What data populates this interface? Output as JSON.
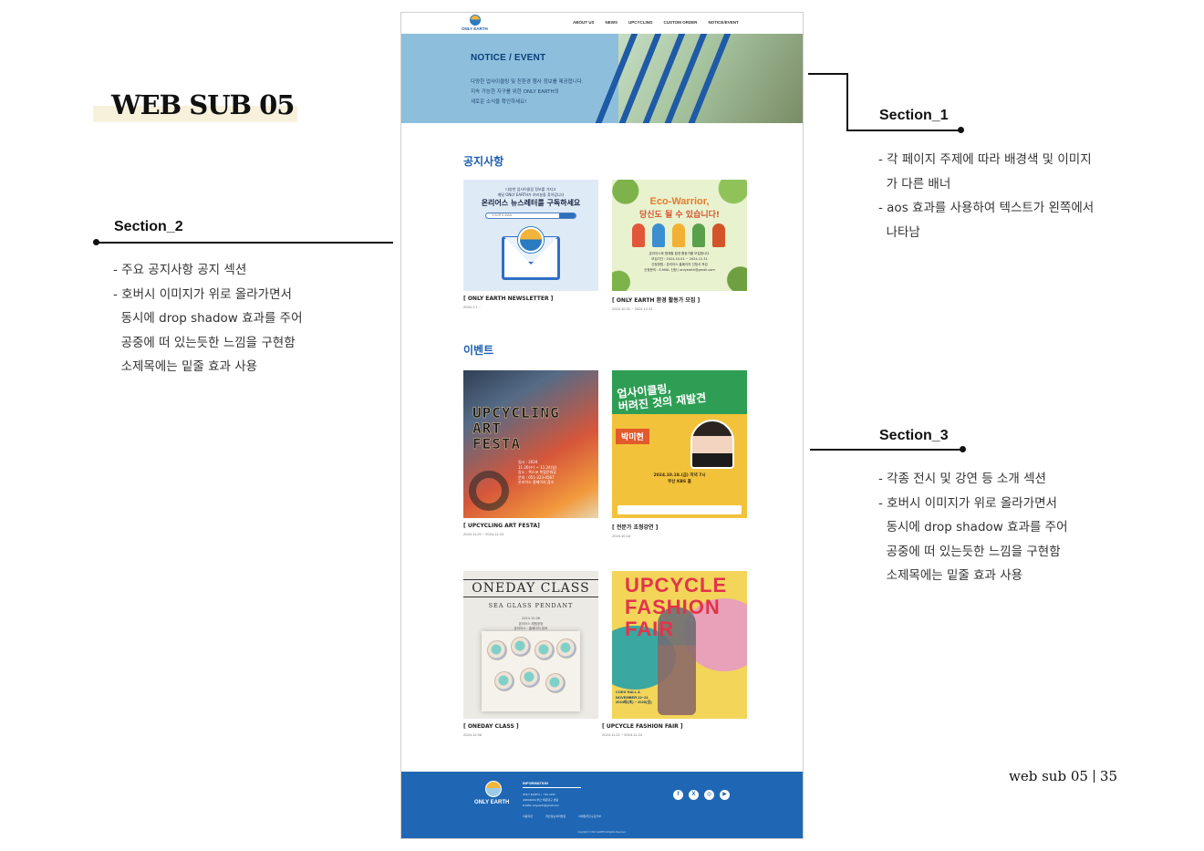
{
  "page_title": "WEB SUB 05",
  "page_number": {
    "label": "web sub 05",
    "num": "35"
  },
  "annotations": {
    "section1": {
      "heading": "Section_1",
      "notes": "- 각 페이지 주제에 따라 배경색 및 이미지\n  가 다른 배너\n- aos 효과를 사용하여 텍스트가 왼쪽에서\n  나타남"
    },
    "section2": {
      "heading": "Section_2",
      "notes": "- 주요 공지사항 공지 섹션\n- 호버시 이미지가 위로 올라가면서\n  동시에 drop shadow 효과를 주어\n  공중에 떠 있는듯한 느낌을 구현함\n  소제목에는 밑줄 효과 사용"
    },
    "section3": {
      "heading": "Section_3",
      "notes": "- 각종 전시 및 강연 등 소개 섹션\n- 호버시 이미지가 위로 올라가면서\n  동시에 drop shadow 효과를 주어\n  공중에 떠 있는듯한 느낌을 구현함\n  소제목에는 밑줄 효과 사용"
    }
  },
  "site": {
    "logo_text": "ONLY EARTH",
    "nav": [
      "ABOUT US",
      "NEWS",
      "UPCYCLING",
      "CUSTOM ORDER",
      "NOTICE/EVENT"
    ],
    "hero": {
      "title": "NOTICE / EVENT",
      "text": "다양한 업사이클링 및 친환경 행사 정보를 제공합니다.\n지속 가능한 지구를 위한 ONLY EARTH의\n새로운 소식을 확인하세요!"
    },
    "notice": {
      "title": "공지사항",
      "cards": [
        {
          "caption": "[ ONLY EARTH NEWSLETTER ]",
          "date": "2024.1.1 ~",
          "poster_lines": "다양한 업사이클링 정보를 가지고\n매달 ONLY EARTH가 여러분을 찾아갑니다",
          "poster_title": "온리어스 뉴스레터를 구독하세요",
          "poster_input": "YOUR E-MAIL"
        },
        {
          "caption": "[ ONLY EARTH 환경 활동가 모집 ]",
          "date": "2024.10.01 ~ 2024.12.31",
          "poster_title": "Eco-Warrior,",
          "poster_sub": "당신도 될 수 있습니다!",
          "poster_info": "온리어스와 함께할 환경 활동가를 모집합니다.\n모집기간 : 2024.10.01 ~ 2024.12.31\n신청방법 : 온리어스 홈페이지 신청서 작성\n신청문의 : E-MAIL 신청 | onlyearth@gmail.com"
        }
      ]
    },
    "event": {
      "title": "이벤트",
      "cards": [
        {
          "caption": "[ UPCYCLING ART FESTA]",
          "date": "2024.11.20 ~ 2024.11.24",
          "poster_title": "UPCYCLING\nART\nFESTA",
          "poster_info": "일시 : 2024\n11.20(수) ~ 11.24(일)\n장소 : 복스꼬 복합문화공\n문의 : 051-223-4567\n온리어스 홈페이지 참조"
        },
        {
          "caption": "[ 전문가 초청강연 ]",
          "date": "2024.10.18",
          "poster_title": "업사이클링,\n버려진 것의 재발견",
          "poster_name": "박미현",
          "poster_info": "2024.10.18.(금) 저녁 7시\n부산 KBS 홀"
        },
        {
          "caption": "[ ONEDAY CLASS ]",
          "date": "2024.12.06",
          "poster_title": "ONEDAY CLASS",
          "poster_sub": "SEA GLASS PENDANT",
          "poster_info": "2024.12.06\n온리어스 체험공방\n온리어스 · 홈페이지 참조"
        },
        {
          "caption": "[ UPCYCLE FASHION FAIR ]",
          "date": "2024.11.22 ~ 2024.11.24",
          "poster_title": "UPCYCLE\nFASHION\nFAIR",
          "poster_info": "COEX HALL A\nNOVEMBER 22~24\n2024年(木) ~ 2025(日)"
        }
      ]
    },
    "footer": {
      "logo_text": "ONLY EARTH",
      "info_head": "INFORMATION",
      "info_lines": "ONLY EARTH  |  TEL 1234\nADDRESS 부산 해운대구 센텀\nE-MAIL onlyearth@gmail.com",
      "links": [
        "이용약관",
        "개인정보처리방침",
        "이메일무단수집거부"
      ],
      "copyright": "Copyright © ONLY EARTH All Rights Reserved.",
      "socials": [
        "f",
        "X",
        "◎",
        "▶"
      ]
    }
  }
}
